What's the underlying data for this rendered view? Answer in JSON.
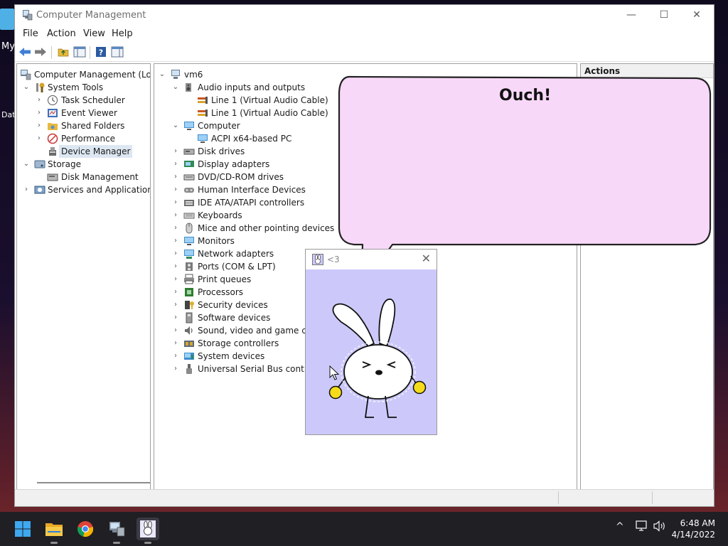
{
  "desktop": {
    "labels": [
      "My",
      "Dat"
    ]
  },
  "window": {
    "title": "Computer Management",
    "controls": {
      "minimize": "—",
      "maximize": "☐",
      "close": "✕"
    },
    "menu": [
      "File",
      "Action",
      "View",
      "Help"
    ]
  },
  "nav_tree": [
    {
      "label": "Computer Management (Local",
      "chev": "",
      "icon": "computer-management-icon"
    },
    {
      "label": "System Tools",
      "chev": "⌄",
      "icon": "system-tools-icon"
    },
    {
      "label": "Task Scheduler",
      "chev": "›",
      "icon": "clock-icon"
    },
    {
      "label": "Event Viewer",
      "chev": "›",
      "icon": "event-viewer-icon"
    },
    {
      "label": "Shared Folders",
      "chev": "›",
      "icon": "shared-folder-icon"
    },
    {
      "label": "Performance",
      "chev": "›",
      "icon": "performance-icon"
    },
    {
      "label": "Device Manager",
      "chev": "",
      "icon": "device-manager-icon"
    },
    {
      "label": "Storage",
      "chev": "⌄",
      "icon": "storage-icon"
    },
    {
      "label": "Disk Management",
      "chev": "",
      "icon": "disk-icon"
    },
    {
      "label": "Services and Applications",
      "chev": "›",
      "icon": "services-icon"
    }
  ],
  "device_tree": [
    {
      "label": "vm6",
      "chev": "⌄",
      "icon": "computer-icon"
    },
    {
      "label": "Audio inputs and outputs",
      "chev": "⌄",
      "icon": "speaker-icon"
    },
    {
      "label": "Line 1 (Virtual Audio Cable)",
      "chev": "",
      "icon": "audio-cable-icon"
    },
    {
      "label": "Line 1 (Virtual Audio Cable)",
      "chev": "",
      "icon": "audio-cable-icon"
    },
    {
      "label": "Computer",
      "chev": "⌄",
      "icon": "monitor-icon"
    },
    {
      "label": "ACPI x64-based PC",
      "chev": "",
      "icon": "monitor-icon"
    },
    {
      "label": "Disk drives",
      "chev": "›",
      "icon": "disk-drive-icon"
    },
    {
      "label": "Display adapters",
      "chev": "›",
      "icon": "display-adapter-icon"
    },
    {
      "label": "DVD/CD-ROM drives",
      "chev": "›",
      "icon": "dvd-drive-icon"
    },
    {
      "label": "Human Interface Devices",
      "chev": "›",
      "icon": "hid-icon"
    },
    {
      "label": "IDE ATA/ATAPI controllers",
      "chev": "›",
      "icon": "ide-controller-icon"
    },
    {
      "label": "Keyboards",
      "chev": "›",
      "icon": "keyboard-icon"
    },
    {
      "label": "Mice and other pointing devices",
      "chev": "›",
      "icon": "mouse-icon"
    },
    {
      "label": "Monitors",
      "chev": "›",
      "icon": "monitor-icon"
    },
    {
      "label": "Network adapters",
      "chev": "›",
      "icon": "network-adapter-icon"
    },
    {
      "label": "Ports (COM & LPT)",
      "chev": "›",
      "icon": "port-icon"
    },
    {
      "label": "Print queues",
      "chev": "›",
      "icon": "printer-icon"
    },
    {
      "label": "Processors",
      "chev": "›",
      "icon": "processor-icon"
    },
    {
      "label": "Security devices",
      "chev": "›",
      "icon": "security-device-icon"
    },
    {
      "label": "Software devices",
      "chev": "›",
      "icon": "software-device-icon"
    },
    {
      "label": "Sound, video and game cont",
      "chev": "›",
      "icon": "sound-icon"
    },
    {
      "label": "Storage controllers",
      "chev": "›",
      "icon": "storage-controller-icon"
    },
    {
      "label": "System devices",
      "chev": "›",
      "icon": "system-devices-icon"
    },
    {
      "label": "Universal Serial Bus controlle",
      "chev": "›",
      "icon": "usb-icon"
    }
  ],
  "actions_pane": {
    "header": "Actions"
  },
  "speech_bubble": {
    "text": "Ouch!"
  },
  "popup": {
    "title": "<3",
    "close": "✕"
  },
  "taskbar": {
    "apps": [
      "start-icon",
      "file-explorer-icon",
      "chrome-icon",
      "computer-management-icon",
      "bunny-app-icon"
    ],
    "tray": {
      "chevron": "^"
    },
    "clock": {
      "time": "6:48 AM",
      "date": "4/14/2022"
    }
  },
  "colors": {
    "selection": "#dde7f2",
    "bubble_fill": "#f8d8f8",
    "popup_bg": "#ccc9fa",
    "taskbar_bg": "#1f1f24"
  }
}
